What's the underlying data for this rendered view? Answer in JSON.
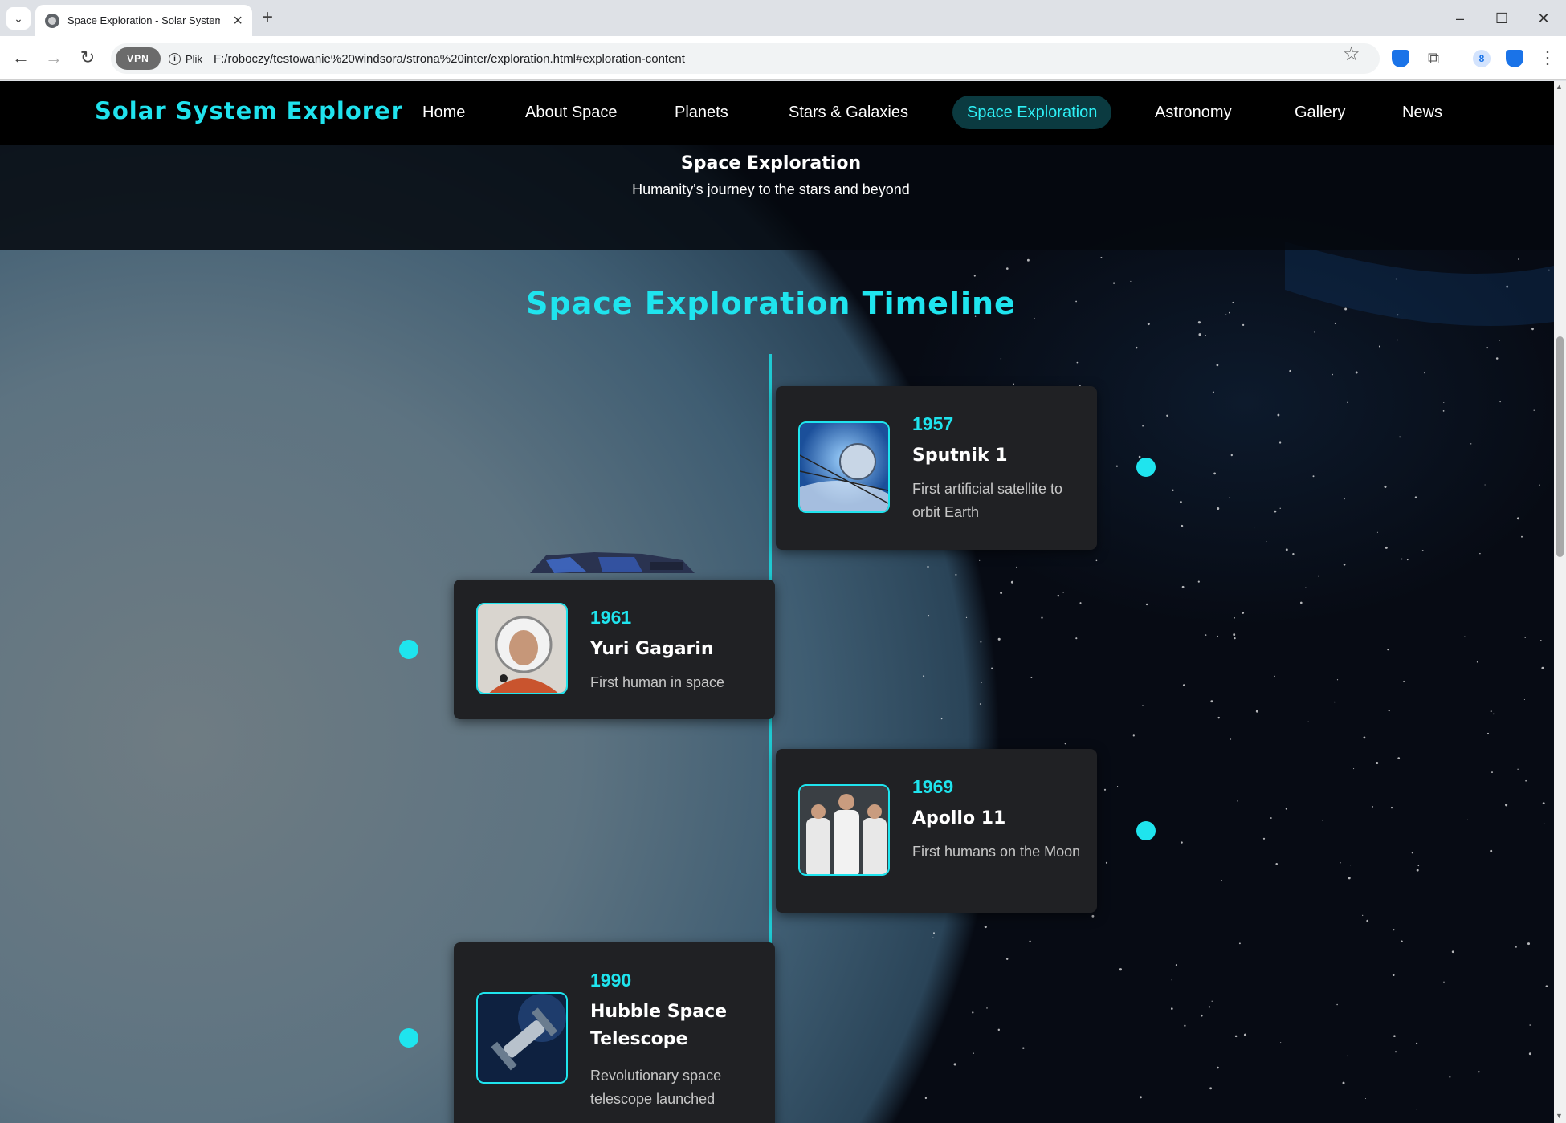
{
  "browser": {
    "tab_title": "Space Exploration - Solar System E",
    "vpn_label": "VPN",
    "info_label": "Plik",
    "url": "F:/roboczy/testowanie%20windsora/strona%20inter/exploration.html#exploration-content",
    "profile_initial": "8"
  },
  "site": {
    "logo": "Solar System Explorer",
    "nav": [
      "Home",
      "About Space",
      "Planets",
      "Stars & Galaxies",
      "Space Exploration",
      "Astronomy",
      "Gallery",
      "News"
    ],
    "active_nav": "Space Exploration",
    "accent_color": "#1fe4ee"
  },
  "hero": {
    "title": "Space Exploration",
    "subtitle": "Humanity's journey to the stars and beyond"
  },
  "timeline": {
    "heading": "Space Exploration Timeline",
    "events": [
      {
        "year": "1957",
        "title": "Sputnik 1",
        "description": "First artificial satellite to orbit Earth",
        "image": "sputnik-satellite"
      },
      {
        "year": "1961",
        "title": "Yuri Gagarin",
        "description": "First human in space",
        "image": "cosmonaut-portrait"
      },
      {
        "year": "1969",
        "title": "Apollo 11",
        "description": "First humans on the Moon",
        "image": "apollo-crew-photo"
      },
      {
        "year": "1990",
        "title": "Hubble Space Telescope",
        "description": "Revolutionary space telescope launched",
        "image": "hubble-telescope"
      }
    ]
  }
}
